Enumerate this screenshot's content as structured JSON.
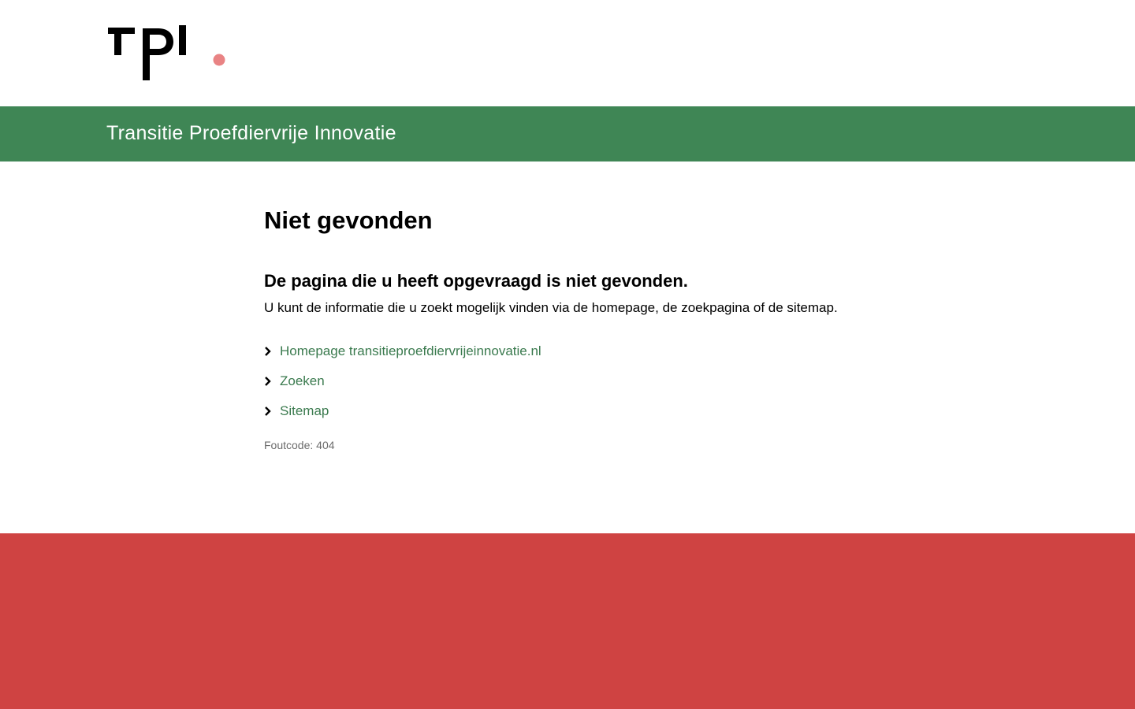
{
  "brand": {
    "logo_text": "tpi",
    "logo_dot_color": "#e98384",
    "site_title": "Transitie Proefdiervrije Innovatie",
    "banner_color": "#3f8655"
  },
  "main": {
    "title": "Niet gevonden",
    "heading": "De pagina die u heeft opgevraagd is niet gevonden.",
    "intro": "U kunt de informatie die u zoekt mogelijk vinden via de homepage, de zoekpagina of de sitemap.",
    "links": [
      {
        "label": "Homepage transitieproefdiervrijeinnovatie.nl",
        "icon": "chevron-right-icon"
      },
      {
        "label": "Zoeken",
        "icon": "chevron-right-icon"
      },
      {
        "label": "Sitemap",
        "icon": "chevron-right-icon"
      }
    ],
    "error_code": "Foutcode: 404",
    "link_color": "#3a7a4e"
  },
  "footer": {
    "color": "#cf4342"
  }
}
